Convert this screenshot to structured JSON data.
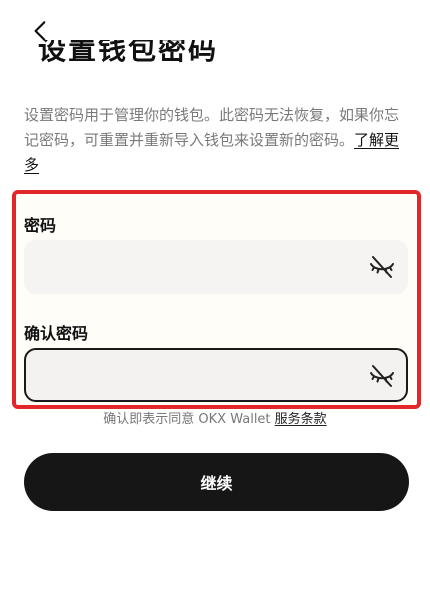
{
  "header": {
    "back_icon": "chevron-left-icon",
    "title": "设置钱包密码"
  },
  "description": {
    "text": "设置密码用于管理你的钱包。此密码无法恢复，如果你忘记密码，可重置并重新导入钱包来设置新的密码。",
    "learn_more": "了解更多"
  },
  "form": {
    "password_label": "密码",
    "password_value": "",
    "confirm_label": "确认密码",
    "confirm_value": "",
    "visibility_icon": "eye-off-icon"
  },
  "terms": {
    "prefix": "确认即表示同意 OKX Wallet ",
    "link": "服务条款"
  },
  "actions": {
    "continue_label": "继续"
  },
  "colors": {
    "primary_button": "#161616",
    "highlight_border": "#e3262a",
    "input_background": "#f5f4f2"
  }
}
